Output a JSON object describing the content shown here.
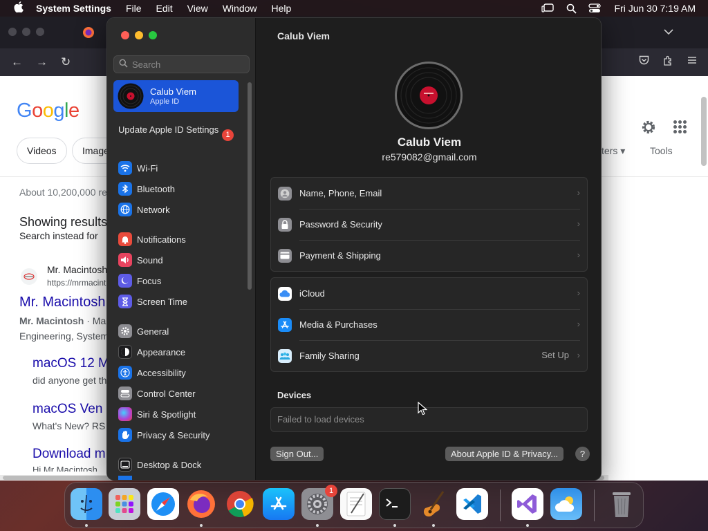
{
  "menubar": {
    "app_name": "System Settings",
    "items": [
      "File",
      "Edit",
      "View",
      "Window",
      "Help"
    ],
    "clock": "Fri Jun 30  7:19 AM"
  },
  "browser": {
    "chips": [
      "Videos",
      "Image"
    ],
    "filters_label": "ters",
    "tools_label": "Tools",
    "results_count": "About 10,200,000 re",
    "showing_results": "Showing results",
    "search_instead": "Search instead for",
    "result1_site": "Mr. Macintosh",
    "result1_url": "https://mrmacint",
    "result1_title": "Mr. Macintosh",
    "result1_snippet_bold": "Mr. Macintosh",
    "result1_snippet": " · Ma",
    "result1_snippet2": "Engineering, System",
    "sub1_title": "macOS 12 M",
    "sub1_text": "did anyone get th",
    "sub2_title": "macOS Ven",
    "sub2_text": "What's New? RS",
    "sub3_title": "Download m",
    "sub3_text": "Hi Mr Macintosh"
  },
  "settings": {
    "search_placeholder": "Search",
    "account": {
      "name": "Calub Viem",
      "subtitle": "Apple ID"
    },
    "update": {
      "label": "Update Apple ID Settings",
      "badge": "1"
    },
    "sidebar_items": [
      {
        "label": "Wi-Fi",
        "icon": "wifi-icon",
        "color": "#1a73e8"
      },
      {
        "label": "Bluetooth",
        "icon": "bluetooth-icon",
        "color": "#1a73e8"
      },
      {
        "label": "Network",
        "icon": "globe-icon",
        "color": "#1a73e8"
      },
      {
        "label": "Notifications",
        "icon": "bell-icon",
        "color": "#ea4b3c"
      },
      {
        "label": "Sound",
        "icon": "speaker-icon",
        "color": "#e9445f"
      },
      {
        "label": "Focus",
        "icon": "moon-icon",
        "color": "#5e5ce6"
      },
      {
        "label": "Screen Time",
        "icon": "hourglass-icon",
        "color": "#5e5ce6"
      },
      {
        "label": "General",
        "icon": "gear-icon",
        "color": "#8e8e93"
      },
      {
        "label": "Appearance",
        "icon": "appearance-icon",
        "color": "#1c1c1e"
      },
      {
        "label": "Accessibility",
        "icon": "accessibility-icon",
        "color": "#1a73e8"
      },
      {
        "label": "Control Center",
        "icon": "control-center-icon",
        "color": "#8e8e93"
      },
      {
        "label": "Siri & Spotlight",
        "icon": "siri-icon",
        "color": "#b042d6"
      },
      {
        "label": "Privacy & Security",
        "icon": "hand-icon",
        "color": "#1a73e8"
      },
      {
        "label": "Desktop & Dock",
        "icon": "dock-icon",
        "color": "#1c1c1e"
      }
    ],
    "title": "Calub Viem",
    "profile_name": "Calub Viem",
    "profile_email": "re579082@gmail.com",
    "group1": [
      {
        "label": "Name, Phone, Email",
        "icon": "contact-card-icon"
      },
      {
        "label": "Password & Security",
        "icon": "lock-icon"
      },
      {
        "label": "Payment & Shipping",
        "icon": "credit-card-icon"
      }
    ],
    "group2": [
      {
        "label": "iCloud",
        "icon": "icloud-icon"
      },
      {
        "label": "Media & Purchases",
        "icon": "app-store-icon"
      },
      {
        "label": "Family Sharing",
        "icon": "family-icon",
        "value": "Set Up"
      }
    ],
    "devices_title": "Devices",
    "devices_status": "Failed to load devices",
    "sign_out_label": "Sign Out...",
    "about_label": "About Apple ID & Privacy...",
    "help_label": "?"
  },
  "dock": {
    "apps": [
      "Finder",
      "Launchpad",
      "Safari",
      "Firefox",
      "Chrome",
      "App Store",
      "System Settings",
      "TextEdit",
      "Terminal",
      "GarageBand",
      "Visual Studio Code",
      "Visual Studio",
      "Weather",
      "Trash"
    ],
    "settings_badge": "1"
  }
}
